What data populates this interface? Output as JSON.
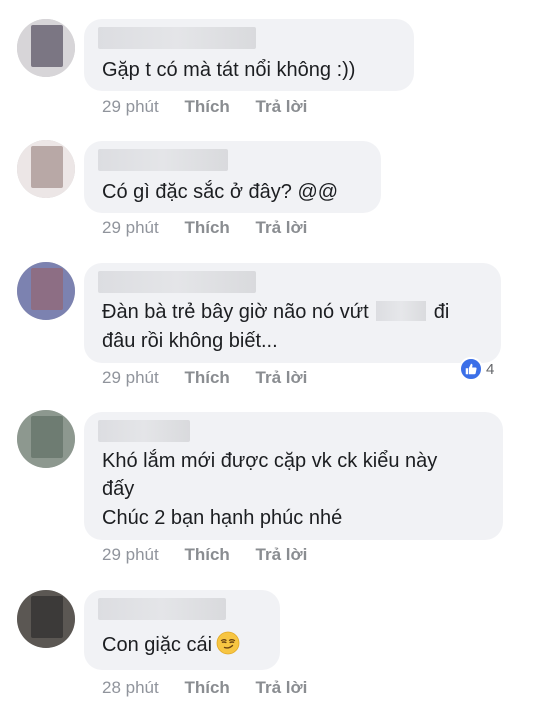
{
  "comments": [
    {
      "text_lines": [
        "Gặp t có mà tát nổi không :))"
      ],
      "time": "29 phút",
      "like_label": "Thích",
      "reply_label": "Trả lời",
      "avatar_colors": [
        "#6d6d80",
        "#8a7e86"
      ]
    },
    {
      "text_lines": [
        "Có gì đặc sắc ở đây? @@"
      ],
      "time": "29 phút",
      "like_label": "Thích",
      "reply_label": "Trả lời",
      "avatar_colors": [
        "#e8e2e2",
        "#b9a9a8"
      ]
    },
    {
      "text_line1_before": "Đàn bà trẻ bây giờ não nó vứt",
      "text_line1_after": "đi",
      "text_line2": "đâu rồi không biết...",
      "time": "29 phút",
      "like_label": "Thích",
      "reply_label": "Trả lời",
      "reaction_count": "4",
      "avatar_colors": [
        "#6e78a8",
        "#8d6f84"
      ]
    },
    {
      "text_lines": [
        "Khó lắm mới được cặp vk ck kiểu này",
        "đấy",
        "Chúc 2 bạn hạnh phúc nhé"
      ],
      "time": "29 phút",
      "like_label": "Thích",
      "reply_label": "Trả lời",
      "avatar_colors": [
        "#6d7a70",
        "#7e8a82"
      ]
    },
    {
      "text": "Con giặc cái",
      "emoji": "smirk-emoji",
      "time": "28 phút",
      "like_label": "Thích",
      "reply_label": "Trả lời",
      "avatar_colors": [
        "#3d3c3c",
        "#5e5a56"
      ]
    }
  ],
  "colors": {
    "bubble": "#f1f2f5",
    "text": "#1c1e21",
    "meta": "#90949c",
    "like_blue": "#3b6fe8"
  }
}
